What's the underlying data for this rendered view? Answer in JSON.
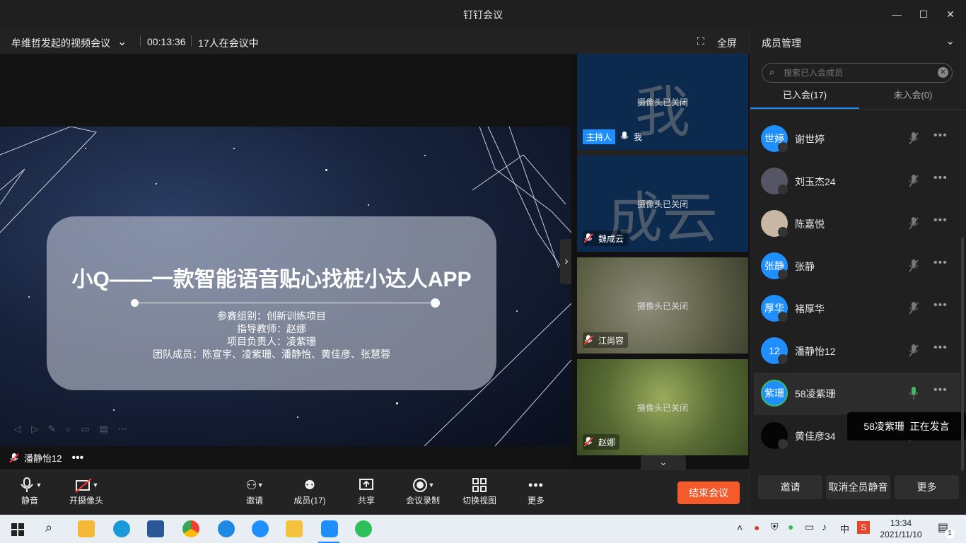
{
  "window": {
    "title": "钉钉会议",
    "controls": [
      "minimize",
      "maximize",
      "close"
    ]
  },
  "infobar": {
    "meeting_title": "牟维哲发起的视频会议",
    "timer": "00:13:36",
    "participants_status": "17人在会议中",
    "fullscreen_label": "全屏"
  },
  "slide": {
    "title": "小Q——一款智能语音贴心找桩小达人APP",
    "lines": [
      "参赛组别：创新训练项目",
      "指导教师：赵娜",
      "项目负责人：凌紫珊",
      "团队成员：陈宣宇、凌紫珊、潘静怡、黄佳彦、张慧蓉"
    ]
  },
  "speaker": {
    "name": "潘静怡12"
  },
  "thumbnails": [
    {
      "big_char": "我",
      "camera_status": "摄像头已关闭",
      "host_badge": "主持人",
      "name": "我",
      "bg": "#0b2a4e",
      "mic": "mic-icon"
    },
    {
      "big_char": "成云",
      "camera_status": "摄像头已关闭",
      "name": "魏成云",
      "bg": "#0b2a4e",
      "mic": "mic-muted-icon"
    },
    {
      "camera_status": "摄像头已关闭",
      "name": "江尚容",
      "bg": "#5e6046",
      "mic": "mic-muted-icon"
    },
    {
      "camera_status": "摄像头已关闭",
      "name": "赵娜",
      "bg": "#586b34",
      "mic": "mic-muted-icon"
    }
  ],
  "toolbar": {
    "mute": "静音",
    "camera": "开摄像头",
    "invite": "邀请",
    "members": "成员(17)",
    "share": "共享",
    "record": "会议录制",
    "switch_view": "切换视图",
    "more": "更多",
    "end_meeting": "结束会议"
  },
  "panel": {
    "title": "成员管理",
    "search_placeholder": "搜索已入会成员",
    "tab_joined": "已入会(17)",
    "tab_not_joined": "未入会(0)",
    "members": [
      {
        "avatar_text": "世婷",
        "name": "谢世婷",
        "avatar_color": "#1f8fff",
        "mic": "mic-muted-icon"
      },
      {
        "avatar_text": "",
        "name": "刘玉杰24",
        "avatar_color": "#556",
        "mic": "mic-muted-icon"
      },
      {
        "avatar_text": "",
        "name": "陈嘉悦",
        "avatar_color": "#c9b7a6",
        "mic": "mic-muted-icon"
      },
      {
        "avatar_text": "张静",
        "name": "张静",
        "avatar_color": "#1f8fff",
        "mic": "mic-muted-icon"
      },
      {
        "avatar_text": "厚华",
        "name": "褚厚华",
        "avatar_color": "#1f8fff",
        "mic": "mic-muted-icon"
      },
      {
        "avatar_text": "12",
        "name": "潘静怡12",
        "avatar_color": "#1f8fff",
        "mic": "mic-muted-icon"
      },
      {
        "avatar_text": "紫珊",
        "name": "58凌紫珊",
        "avatar_color": "#1f8fff",
        "mic": "mic-active-icon"
      },
      {
        "avatar_text": "",
        "name": "黄佳彦34",
        "avatar_color": "#050505",
        "mic": "mic-muted-icon"
      }
    ],
    "speaking_tooltip": "58凌紫珊  正在发言",
    "btn_invite": "邀请",
    "btn_unmute_all": "取消全员静音",
    "btn_more": "更多"
  },
  "taskbar": {
    "ime": "中",
    "time": "13:34",
    "date": "2021/11/10",
    "notification_count": "1"
  },
  "colors": {
    "accent": "#1f8fff",
    "end_meeting": "#f55a2a",
    "active_mic": "#3dbd62"
  }
}
